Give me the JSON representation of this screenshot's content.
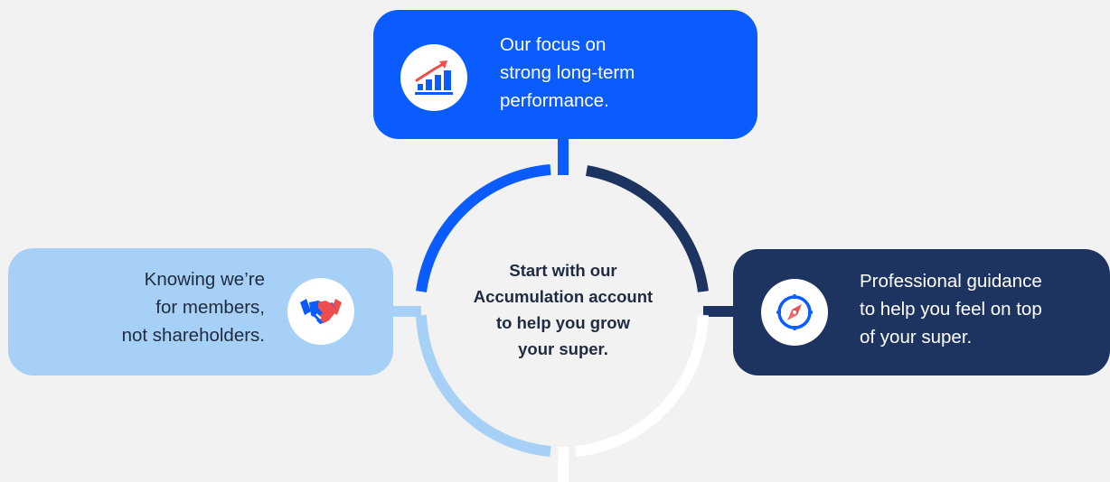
{
  "center": {
    "text": "Start with our\nAccumulation account\nto help you grow\nyour super."
  },
  "boxes": {
    "top": {
      "text": "Our focus on\nstrong long-term\nperformance.",
      "icon": "growth-chart-icon",
      "color": "#0a5cff"
    },
    "left": {
      "text": "Knowing we’re\nfor members,\nnot shareholders.",
      "icon": "handshake-icon",
      "color": "#a7d0f6"
    },
    "right": {
      "text": "Professional guidance\nto help you feel on top\nof your super.",
      "icon": "compass-icon",
      "color": "#1d3460"
    }
  },
  "colors": {
    "background": "#f2f2f2",
    "blue": "#0a5cff",
    "light_blue": "#a7d0f6",
    "navy": "#1d3460",
    "white": "#ffffff",
    "accent_red": "#ee4d4d"
  }
}
